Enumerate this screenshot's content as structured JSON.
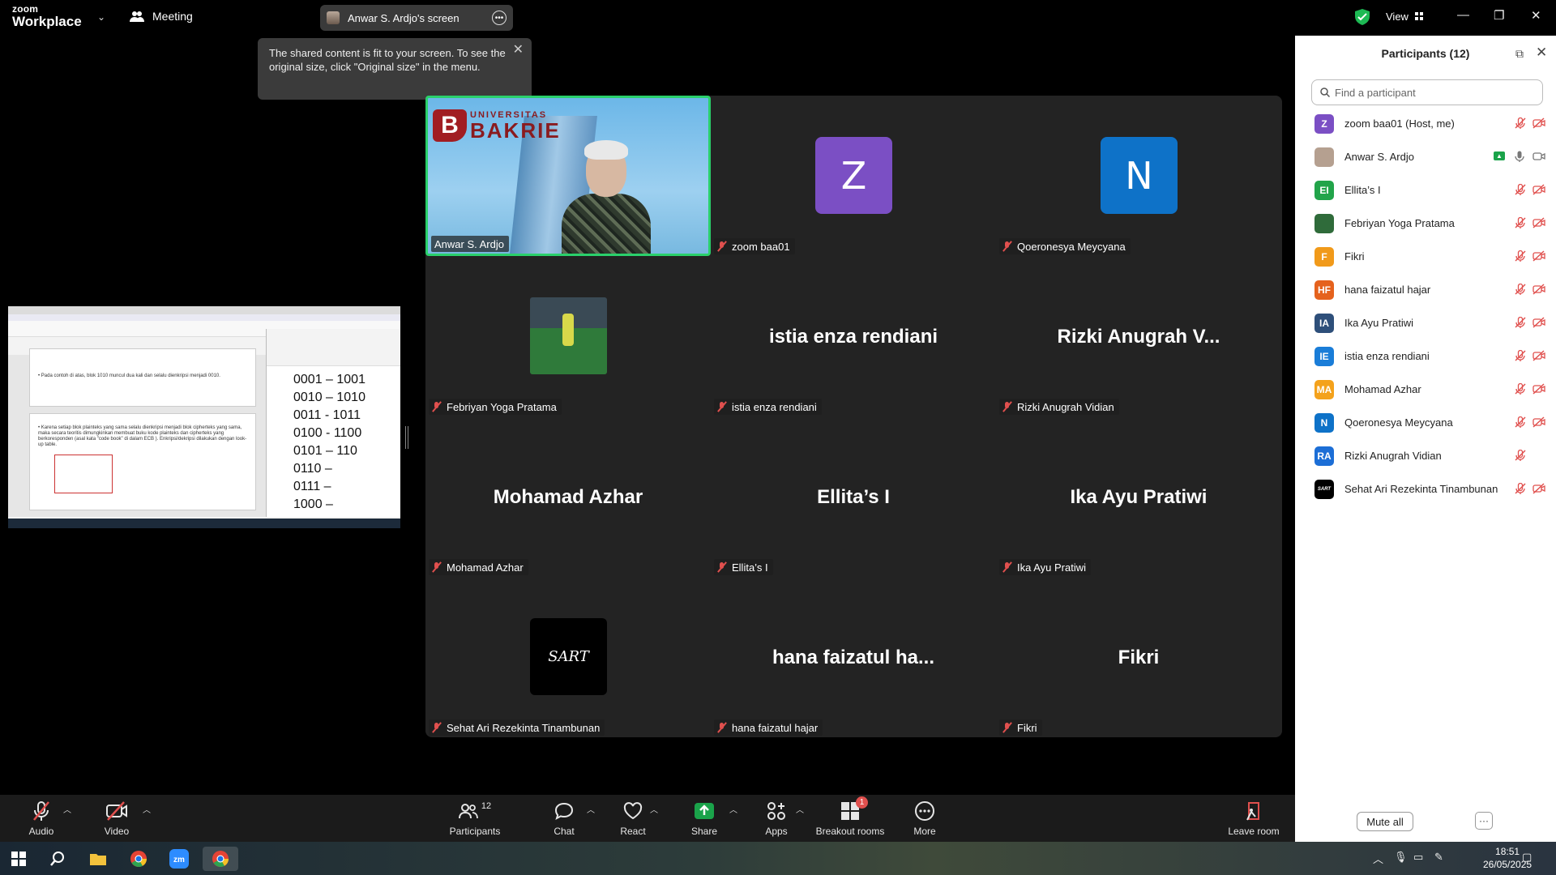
{
  "app": {
    "brand_line1": "zoom",
    "brand_line2": "Workplace",
    "meeting_label": "Meeting",
    "view_label": "View"
  },
  "share_pill": {
    "label": "Anwar S. Ardjo's screen"
  },
  "tooltip": {
    "text": "The shared content is fit to your screen. To see the original size, click \"Original size\" in the menu."
  },
  "shared_doc": {
    "lines": [
      "0001 – 1001",
      "0010 – 1010",
      "0011 - 1011",
      "0100 - 1100",
      "0101 – 110",
      "0110 –",
      "0111 –",
      "1000 –"
    ],
    "slide1": "• Pada contoh di atas, blok 1010 muncul dua kali dan selalu dienkripsi menjadi 0010.",
    "slide2": "• Karena setiap blok plainteks yang sama selalu dienkripsi menjadi blok cipherteks yang sama, maka secara teoritis dimungkinkan membuat buku kode plainteks dan cipherteks yang berkoresponden (asal kata \"code book\" di dalam ECB ). Enkripsi/dekripsi dilakukan dengan look-up table."
  },
  "gallery": {
    "tiles": [
      {
        "label": "Anwar S. Ardjo",
        "type": "video"
      },
      {
        "label": "zoom baa01",
        "type": "avatar",
        "initial": "Z",
        "color": "#7b4fc4"
      },
      {
        "label": "Qoeronesya Meycyana",
        "type": "avatar",
        "initial": "N",
        "color": "#0e72c8"
      },
      {
        "label": "Febriyan Yoga Pratama",
        "type": "photo"
      },
      {
        "label": "istia enza rendiani",
        "type": "name",
        "big": "istia enza rendiani"
      },
      {
        "label": "Rizki Anugrah Vidian",
        "type": "name",
        "big": "Rizki Anugrah V..."
      },
      {
        "label": "Mohamad Azhar",
        "type": "name",
        "big": "Mohamad Azhar"
      },
      {
        "label": "Ellita’s I",
        "type": "name",
        "big": "Ellita’s I"
      },
      {
        "label": "Ika Ayu Pratiwi",
        "type": "name",
        "big": "Ika Ayu Pratiwi"
      },
      {
        "label": "Sehat Ari Rezekinta Tinambunan",
        "type": "sart",
        "mark": "SART"
      },
      {
        "label": "hana faizatul hajar",
        "type": "name",
        "big": "hana faizatul ha..."
      },
      {
        "label": "Fikri",
        "type": "name",
        "big": "Fikri"
      }
    ],
    "logo": {
      "line1": "UNIVERSITAS",
      "line2": "BAKRIE",
      "mark": "B"
    }
  },
  "participants": {
    "title": "Participants (12)",
    "search_placeholder": "Find a participant",
    "list": [
      {
        "initials": "Z",
        "name": "zoom baa01 (Host, me)",
        "color": "#7b4fc4"
      },
      {
        "initials": "",
        "name": "Anwar S. Ardjo",
        "color": "#b5a090",
        "photo": true,
        "sharing": true
      },
      {
        "initials": "EI",
        "name": "Ellita’s I",
        "color": "#22a44a"
      },
      {
        "initials": "",
        "name": "Febriyan Yoga Pratama",
        "color": "#2f6b3a",
        "photo": true
      },
      {
        "initials": "F",
        "name": "Fikri",
        "color": "#f19a1a"
      },
      {
        "initials": "HF",
        "name": "hana faizatul hajar",
        "color": "#e5621d"
      },
      {
        "initials": "IA",
        "name": "Ika Ayu Pratiwi",
        "color": "#2e4f7a"
      },
      {
        "initials": "IE",
        "name": "istia enza rendiani",
        "color": "#1a7dd8"
      },
      {
        "initials": "MA",
        "name": "Mohamad Azhar",
        "color": "#f4a21c"
      },
      {
        "initials": "N",
        "name": "Qoeronesya Meycyana",
        "color": "#0e72c8"
      },
      {
        "initials": "RA",
        "name": "Rizki Anugrah Vidian",
        "color": "#1c6ed6",
        "no_cam_icon": true
      },
      {
        "initials": "SART",
        "name": "Sehat Ari Rezekinta Tinambunan",
        "color": "#000000"
      }
    ],
    "mute_all": "Mute all"
  },
  "toolbar": {
    "audio": "Audio",
    "video": "Video",
    "participants": "Participants",
    "participants_count": "12",
    "chat": "Chat",
    "react": "React",
    "share": "Share",
    "apps": "Apps",
    "breakout": "Breakout rooms",
    "breakout_badge": "1",
    "more": "More",
    "leave": "Leave room"
  },
  "taskbar": {
    "time": "18:51",
    "date": "26/05/2025"
  },
  "colors": {
    "accent_green": "#2ad06b",
    "mic_off_red": "#e0504e",
    "share_green": "#1aa34a"
  }
}
